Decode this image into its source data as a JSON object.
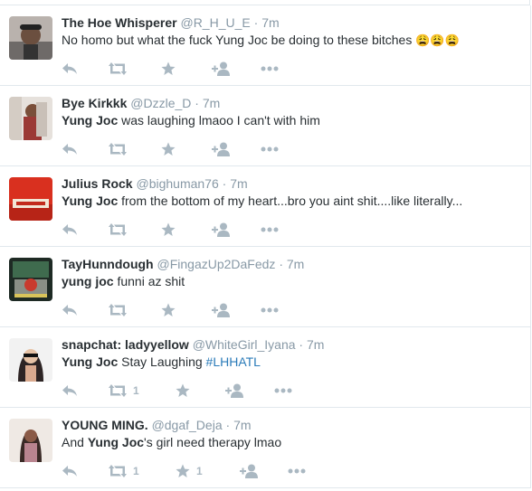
{
  "tweets": [
    {
      "name": "The Hoe Whisperer",
      "handle": "@R_H_U_E",
      "time": "7m",
      "text": "No homo but what the fuck Yung Joc be doing to these bitches",
      "emoji": "😩😩😩",
      "avatar_color": "#5b5b61"
    },
    {
      "name": "Bye Kirkkk",
      "handle": "@Dzzle_D",
      "time": "7m",
      "bold": "Yung Joc",
      "text": " was laughing lmaoo I can't with him",
      "avatar_color": "#8a5f4d"
    },
    {
      "name": "Julius Rock",
      "handle": "@bighuman76",
      "time": "7m",
      "bold": "Yung Joc",
      "text": " from the bottom of my heart...bro you aint shit....like literally...",
      "avatar_color": "#d9301f"
    },
    {
      "name": "TayHunndough",
      "handle": "@FingazUp2DaFedz",
      "time": "7m",
      "bold": "yung joc",
      "text": " funni az shit",
      "avatar_color": "#2d4a3b"
    },
    {
      "name": "snapchat: ladyyellow",
      "handle": "@WhiteGirl_Iyana",
      "time": "7m",
      "bold": "Yung Joc",
      "text": " Stay Laughing ",
      "hashtag": "#LHHATL",
      "retweets": "1",
      "avatar_color": "#3d3536"
    },
    {
      "name": "YOUNG MING.",
      "handle": "@dgaf_Deja",
      "time": "7m",
      "pre": "And ",
      "bold": "Yung Joc",
      "text": "'s girl need therapy lmao",
      "retweets": "1",
      "favorites": "1",
      "avatar_color": "#6a4e44"
    }
  ],
  "icons": {
    "reply": "reply-icon",
    "retweet": "retweet-icon",
    "favorite": "star-icon",
    "follow": "follow-icon",
    "more": "more-icon"
  },
  "colors": {
    "text": "#292f33",
    "muted": "#8899a6",
    "action": "#aab8c2",
    "hashtag": "#2b7bb9",
    "divider": "#e1e8ed"
  }
}
